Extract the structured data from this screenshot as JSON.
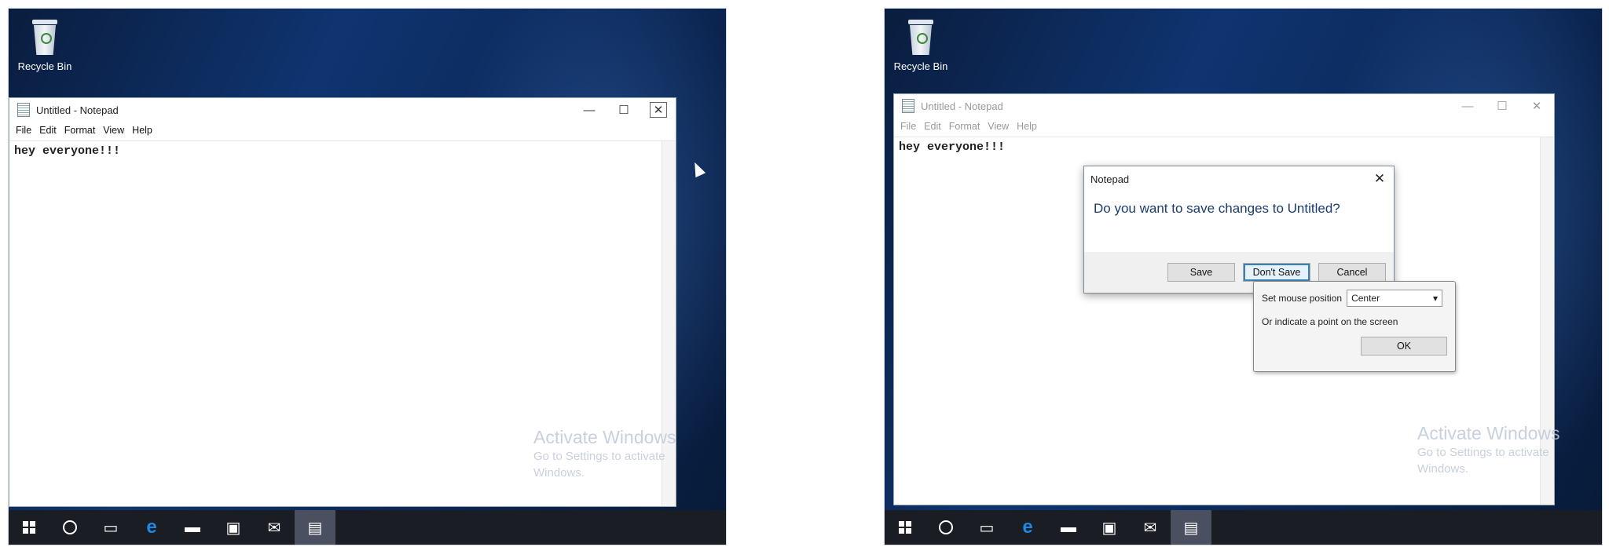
{
  "left": {
    "desktop": {
      "recycle_bin": "Recycle Bin"
    },
    "notepad": {
      "title": "Untitled - Notepad",
      "window_buttons": {
        "minimize": "—",
        "maximize": "☐",
        "close": "✕"
      },
      "menu": [
        "File",
        "Edit",
        "Format",
        "View",
        "Help"
      ],
      "content": "hey everyone!!!"
    },
    "watermark": {
      "line1": "Activate Windows",
      "line2": "Go to Settings to activate",
      "line3": "Windows."
    }
  },
  "right": {
    "desktop": {
      "recycle_bin": "Recycle Bin"
    },
    "notepad": {
      "title": "Untitled - Notepad",
      "window_buttons": {
        "minimize": "—",
        "maximize": "☐",
        "close": "✕"
      },
      "menu": [
        "File",
        "Edit",
        "Format",
        "View",
        "Help"
      ],
      "content": "hey everyone!!!"
    },
    "dialog": {
      "title": "Notepad",
      "close": "✕",
      "question": "Do you want to save changes to Untitled?",
      "buttons": [
        "Save",
        "Don't Save",
        "Cancel"
      ]
    },
    "popup": {
      "label": "Set mouse position",
      "select_value": "Center",
      "hint": "Or indicate a point on the screen",
      "ok": "OK"
    },
    "watermark": {
      "line1": "Activate Windows",
      "line2": "Go to Settings to activate",
      "line3": "Windows."
    }
  },
  "taskbar": {
    "icons": [
      "start-icon",
      "cortana-icon",
      "task-view-icon",
      "edge-icon",
      "file-explorer-icon",
      "store-icon",
      "mail-icon",
      "notepad-icon"
    ]
  },
  "colors": {
    "desktop": "#0f3470",
    "taskbar": "#1b1d24",
    "dialog_text": "#1a3c6e"
  }
}
